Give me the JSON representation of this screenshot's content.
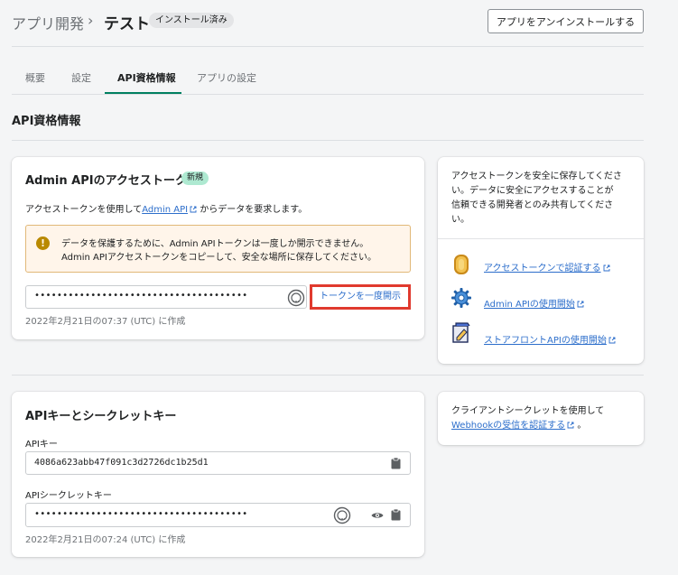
{
  "breadcrumb": {
    "parent": "アプリ開発",
    "separator": "›",
    "current": "テスト",
    "status": "インストール済み"
  },
  "header": {
    "uninstall_label": "アプリをアンインストールする"
  },
  "tabs": [
    {
      "label": "概要",
      "active": false
    },
    {
      "label": "設定",
      "active": false
    },
    {
      "label": "API資格情報",
      "active": true
    },
    {
      "label": "アプリの設定",
      "active": false
    }
  ],
  "section_title": "API資格情報",
  "admin_card": {
    "title": "Admin APIのアクセストークン",
    "badge": "新規",
    "desc_before": "アクセストークンを使用して",
    "desc_link": "Admin API",
    "desc_after": "からデータを要求します。",
    "banner_line1": "データを保護するために、Admin APIトークンは一度しか開示できません。",
    "banner_line2": "Admin APIアクセストークンをコピーして、安全な場所に保存してください。",
    "token_masked": "••••••••••••••••••••••••••••••••••••••",
    "reveal_label": "トークンを一度開示",
    "created": "2022年2月21日の07:37 (UTC) に作成"
  },
  "admin_side": {
    "text_lines": [
      "アクセストークンを安全に保存してくださ",
      "い。データに安全にアクセスすることが",
      "信頼できる開発者とのみ共有してくださ",
      "い。"
    ],
    "links": [
      {
        "label": "アクセストークンで認証する",
        "icon": "coin-icon"
      },
      {
        "label": "Admin APIの使用開始",
        "icon": "gear-icon"
      },
      {
        "label": "ストアフロントAPIの使用開始",
        "icon": "storefront-icon"
      }
    ]
  },
  "keys_card": {
    "title": "APIキーとシークレットキー",
    "api_key_label": "APIキー",
    "api_key_value": "4086a623abb47f091c3d2726dc1b25d1",
    "secret_label": "APIシークレットキー",
    "secret_masked": "••••••••••••••••••••••••••••••••••••••",
    "created": "2022年2月21日の07:24 (UTC) に作成"
  },
  "keys_side": {
    "line1": "クライアントシークレットを使用して",
    "link": "Webhookの受信を認証する",
    "after": "。"
  },
  "colors": {
    "accent": "#008060",
    "link": "#2c6ecb",
    "highlight": "#e03a2e",
    "warning": "#b98900",
    "badge_new": "#aee9d1"
  }
}
